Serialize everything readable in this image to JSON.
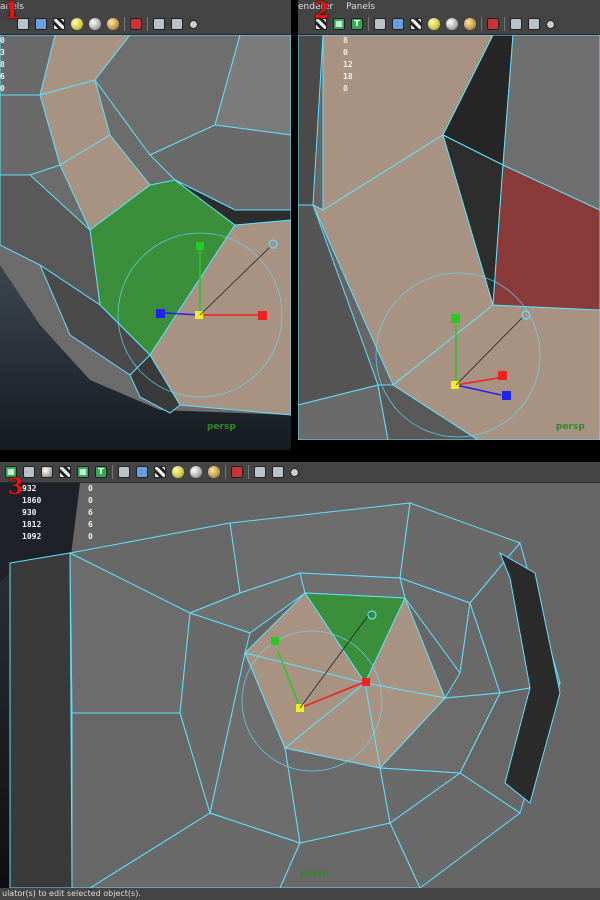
{
  "panels": {
    "p1": {
      "step_label": "1",
      "menu": [
        "anels"
      ],
      "stats": [
        "0",
        "3",
        "8",
        "6",
        "0"
      ],
      "camera": "persp",
      "bottom_hint": "..."
    },
    "p2": {
      "step_label": "2",
      "menu": [
        "enderer",
        "Panels"
      ],
      "stats": [
        "8",
        "0",
        "12",
        "18",
        "0"
      ],
      "camera": "persp"
    },
    "p3": {
      "step_label": "3",
      "stats_left": [
        "932",
        "1860",
        "930",
        "1812",
        "1092"
      ],
      "stats_right": [
        "0",
        "0",
        "6",
        "6",
        "0"
      ],
      "camera": "persp",
      "status": "ulator(s) to edit selected object(s)."
    }
  },
  "colors": {
    "wire": "#5fe0ff",
    "face_selected": "#3b8f3b",
    "face_highlight": "#b09480",
    "face_red": "#8b3a3a",
    "mesh_gray": "#6b6b6b"
  },
  "icons": [
    "grid-icon",
    "cube-icon",
    "checker-icon",
    "sphere-icon",
    "select-icon",
    "share-icon"
  ]
}
